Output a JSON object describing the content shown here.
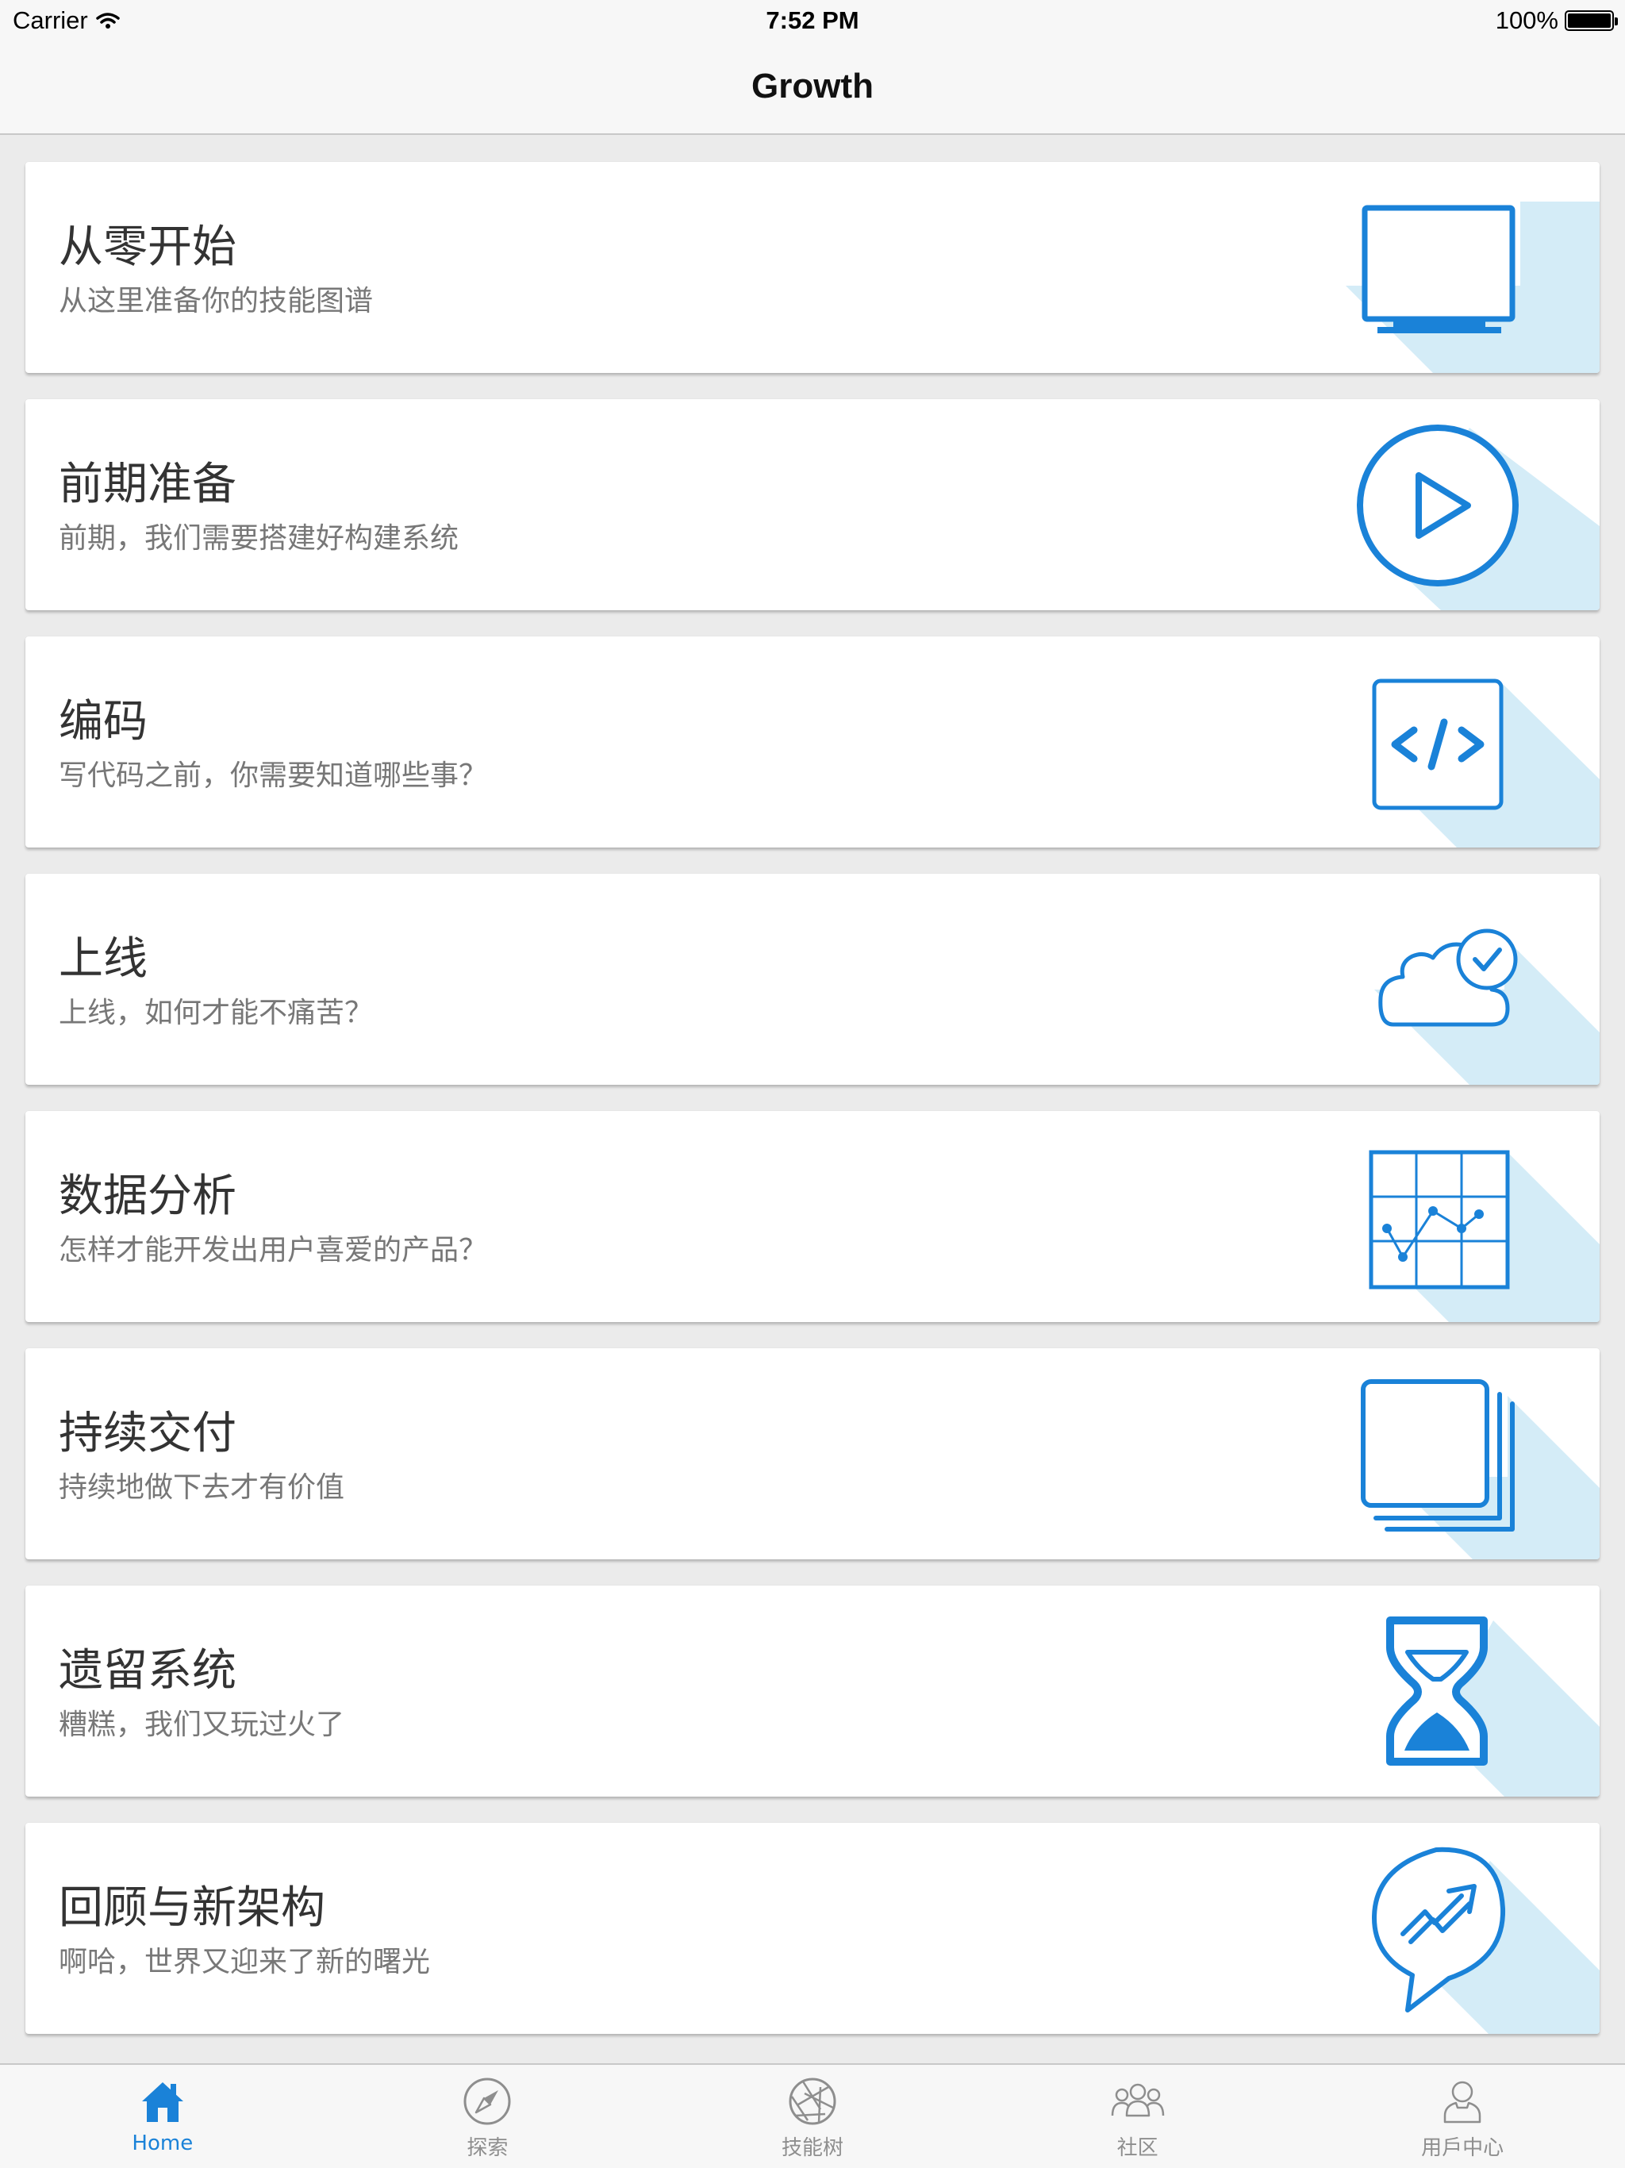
{
  "status_bar": {
    "carrier": "Carrier",
    "time": "7:52 PM",
    "battery": "100%",
    "battery_level": 1.0
  },
  "nav": {
    "title": "Growth"
  },
  "accent_color": "#1a82d8",
  "shadow_color": "#d4ecf7",
  "cards": [
    {
      "title": "从零开始",
      "subtitle": "从这里准备你的技能图谱",
      "icon": "monitor-icon"
    },
    {
      "title": "前期准备",
      "subtitle": "前期，我们需要搭建好构建系统",
      "icon": "play-circle-icon"
    },
    {
      "title": "编码",
      "subtitle": "写代码之前，你需要知道哪些事？",
      "icon": "code-icon"
    },
    {
      "title": "上线",
      "subtitle": "上线，如何才能不痛苦？",
      "icon": "cloud-check-icon"
    },
    {
      "title": "数据分析",
      "subtitle": "怎样才能开发出用户喜爱的产品？",
      "icon": "chart-grid-icon"
    },
    {
      "title": "持续交付",
      "subtitle": "持续地做下去才有价值",
      "icon": "stacked-layers-icon"
    },
    {
      "title": "遗留系统",
      "subtitle": "糟糕，我们又玩过火了",
      "icon": "hourglass-icon"
    },
    {
      "title": "回顾与新架构",
      "subtitle": "啊哈，世界又迎来了新的曙光",
      "icon": "trend-bubble-icon"
    }
  ],
  "tabs": [
    {
      "label": "Home",
      "icon": "home-icon",
      "active": true
    },
    {
      "label": "探索",
      "icon": "compass-icon",
      "active": false
    },
    {
      "label": "技能树",
      "icon": "aperture-icon",
      "active": false
    },
    {
      "label": "社区",
      "icon": "community-icon",
      "active": false
    },
    {
      "label": "用戶中心",
      "icon": "user-icon",
      "active": false
    }
  ]
}
